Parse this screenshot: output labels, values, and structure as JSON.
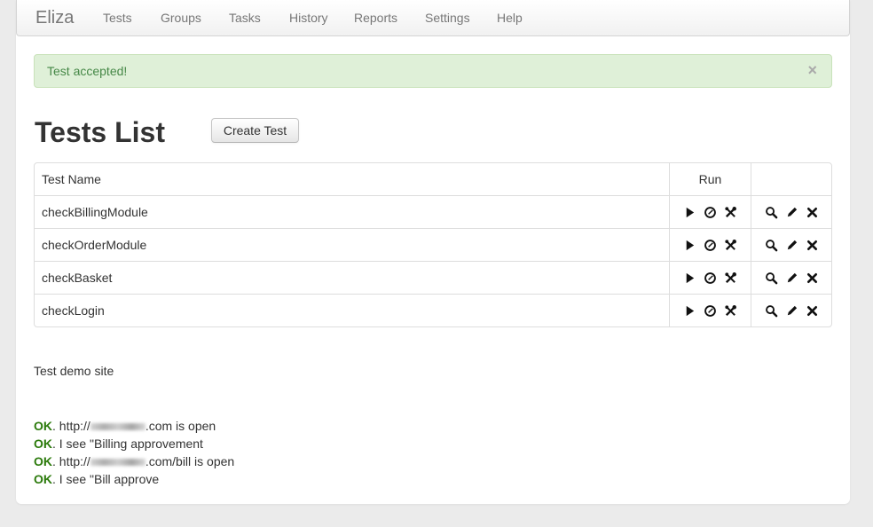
{
  "navbar": {
    "brand": "Eliza",
    "items": [
      "Tests",
      "Groups",
      "Tasks",
      "History",
      "Reports",
      "Settings",
      "Help"
    ]
  },
  "alert": {
    "text": "Test accepted!",
    "close_label": "×"
  },
  "page": {
    "title": "Tests List",
    "create_button": "Create Test"
  },
  "table": {
    "headers": {
      "name": "Test Name",
      "run": "Run",
      "actions": ""
    },
    "rows": [
      {
        "name": "checkBillingModule"
      },
      {
        "name": "checkOrderModule"
      },
      {
        "name": "checkBasket"
      },
      {
        "name": "checkLogin"
      }
    ],
    "run_icons": [
      "play-icon",
      "clock-icon",
      "tools-icon"
    ],
    "action_icons": [
      "search-icon",
      "pencil-icon",
      "delete-icon"
    ]
  },
  "description": "Test demo site",
  "log": [
    {
      "status": "OK",
      "prefix": ". http://",
      "redacted": true,
      "suffix": ".com is open"
    },
    {
      "status": "OK",
      "prefix": ". I see \"Billing approvement",
      "redacted": false,
      "suffix": ""
    },
    {
      "status": "OK",
      "prefix": ". http://",
      "redacted": true,
      "suffix": ".com/bill is open"
    },
    {
      "status": "OK",
      "prefix": ". I see \"Bill approve",
      "redacted": false,
      "suffix": ""
    }
  ],
  "colors": {
    "ok_green": "#2b7a0b",
    "alert_bg": "#dff0d8",
    "alert_text": "#468847"
  }
}
